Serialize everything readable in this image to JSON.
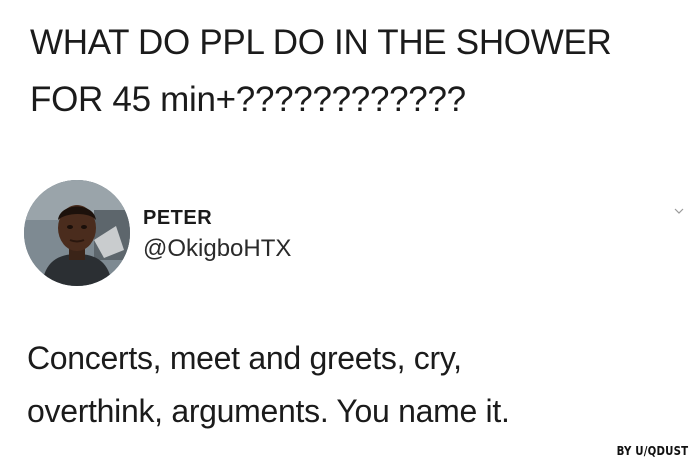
{
  "tweet_quote": {
    "line1": "WHAT DO PPL DO IN THE SHOWER",
    "line2": "FOR 45 min+????????????"
  },
  "reply": {
    "name": "PETER",
    "handle": "@OkigboHTX",
    "text_line1": "Concerts, meet and greets, cry,",
    "text_line2": "overthink, arguments. You name it."
  },
  "watermark": "BY U/QDUST",
  "icons": {
    "avatar": "profile-photo",
    "chevron": "chevron-down-icon"
  }
}
